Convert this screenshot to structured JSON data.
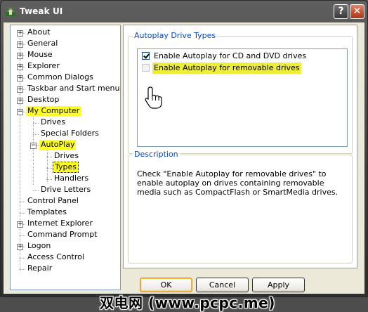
{
  "window": {
    "title": "Tweak UI",
    "help_label": "?",
    "close_label": "✕"
  },
  "tree": [
    {
      "label": "About",
      "expander": "+"
    },
    {
      "label": "General",
      "expander": "+"
    },
    {
      "label": "Mouse",
      "expander": "+"
    },
    {
      "label": "Explorer",
      "expander": "+"
    },
    {
      "label": "Common Dialogs",
      "expander": "+"
    },
    {
      "label": "Taskbar and Start menu",
      "expander": "+"
    },
    {
      "label": "Desktop",
      "expander": "+"
    },
    {
      "label": "My Computer",
      "expander": "−",
      "highlight": true
    },
    {
      "label": "Drives"
    },
    {
      "label": "Special Folders"
    },
    {
      "label": "AutoPlay",
      "expander": "−",
      "highlight": true
    },
    {
      "label": "Drives"
    },
    {
      "label": "Types",
      "highlight": true,
      "selected": true
    },
    {
      "label": "Handlers"
    },
    {
      "label": "Drive Letters"
    },
    {
      "label": "Control Panel"
    },
    {
      "label": "Templates"
    },
    {
      "label": "Internet Explorer",
      "expander": "+"
    },
    {
      "label": "Command Prompt"
    },
    {
      "label": "Logon",
      "expander": "+"
    },
    {
      "label": "Access Control"
    },
    {
      "label": "Repair"
    }
  ],
  "autoplay": {
    "group_title": "Autoplay Drive Types",
    "options": [
      {
        "label": "Enable Autoplay for CD and DVD drives",
        "checked": true
      },
      {
        "label": "Enable Autoplay for removable drives",
        "checked": false,
        "highlight": true
      }
    ]
  },
  "description": {
    "group_title": "Description",
    "text": "Check \"Enable Autoplay for removable drives\" to enable autoplay on drives containing removable media such as CompactFlash or SmartMedia drives."
  },
  "buttons": {
    "ok": "OK",
    "cancel": "Cancel",
    "apply": "Apply"
  },
  "watermark": "双电网 (www.pcpc.me)",
  "colors": {
    "highlight": "#ffff24",
    "group_title": "#0046d5",
    "titlebar": "#3c3c3c"
  }
}
